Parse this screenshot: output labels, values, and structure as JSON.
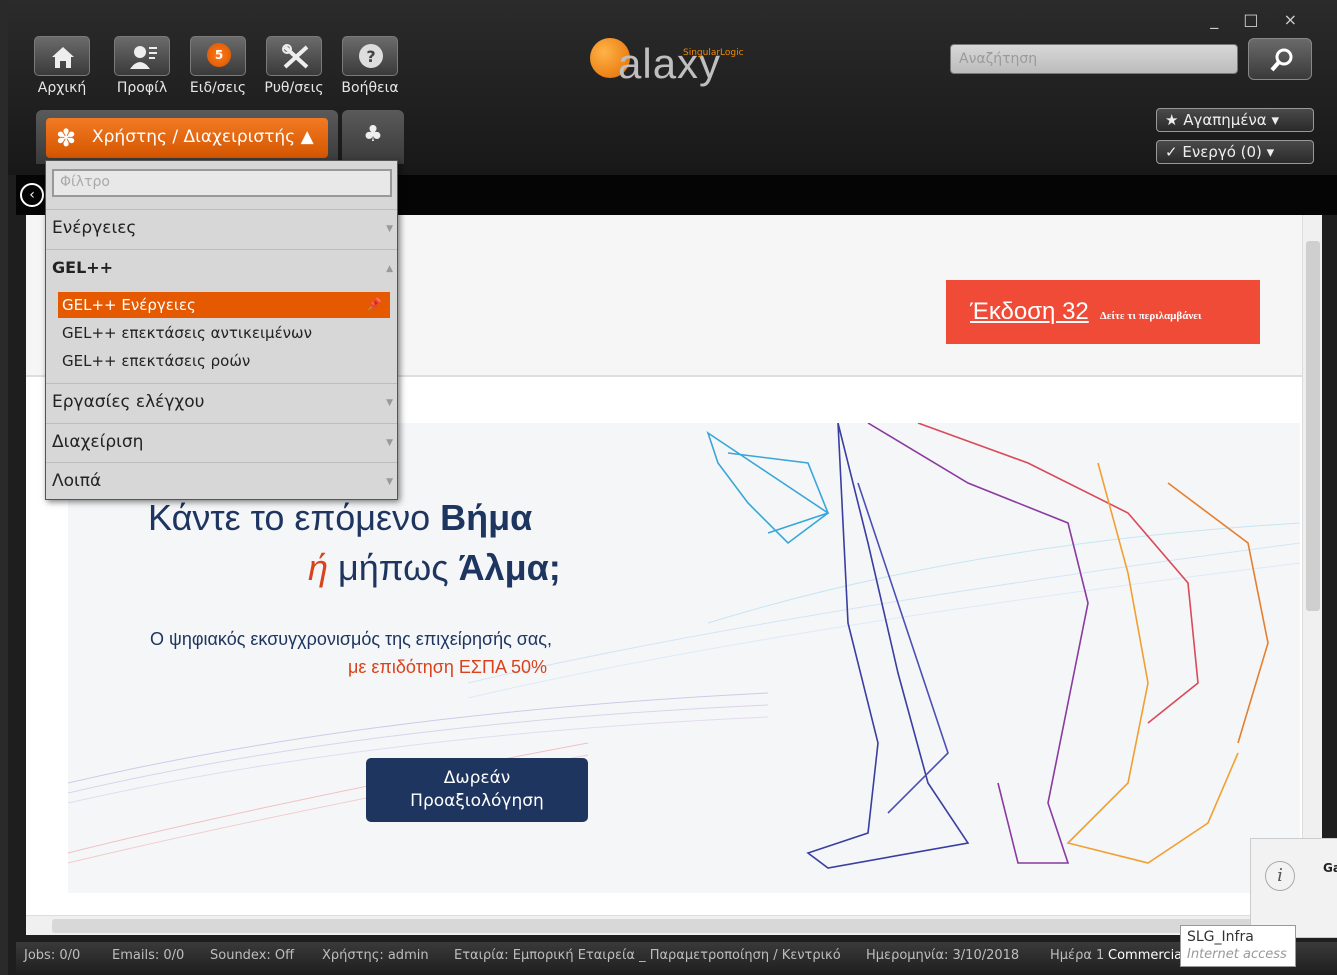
{
  "window": {
    "controls": "_ □ ×"
  },
  "nav": {
    "home": "Αρχική",
    "profile": "Προφίλ",
    "notifications": "Ειδ/σεις",
    "notifications_count": "5",
    "settings": "Ρυθ/σεις",
    "help": "Βοήθεια"
  },
  "logo": {
    "word": "alaxy",
    "brand": "SingularLogic"
  },
  "search": {
    "placeholder": "Αναζήτηση"
  },
  "favorites": "★ Αγαπημένα ▾",
  "active": "✓ Ενεργό (0) ▾",
  "role": {
    "label": "Χρήστης / Διαχειριστής ▲"
  },
  "menu": {
    "filter_placeholder": "Φίλτρο",
    "sections": [
      "Ενέργειες",
      "GEL++",
      "Εργασίες ελέγχου",
      "Διαχείριση",
      "Λοιπά"
    ],
    "gel_items": [
      "GEL++ Ενέργειες",
      "GEL++ επεκτάσεις αντικειμένων",
      "GEL++ επεκτάσεις ροών"
    ]
  },
  "version": {
    "label": "Έκδοση 32",
    "sub": "Δείτε τι περιλαμβάνει"
  },
  "banner": {
    "line1_a": "Κάντε το επόμενο ",
    "line1_b": "Βήμα",
    "line2_or": "ή",
    "line2_a": " μήπως ",
    "line2_b": "Άλμα;",
    "sub1": "Ο ψηφιακός εκσυγχρονισμός της επιχείρησής σας,",
    "sub2": "με επιδότηση ΕΣΠΑ 50%",
    "cta_line1": "Δωρεάν",
    "cta_line2": "Προαξιολόγηση"
  },
  "status": {
    "jobs": "Jobs: 0/0",
    "emails": "Emails: 0/0",
    "soundex": "Soundex: Off",
    "user": "Χρήστης: admin",
    "company": "Εταιρία: Εμπορική Εταιρεία _ Παραμετροποίηση / Κεντρικό",
    "date": "Ημερομηνία: 3/10/2018",
    "day": "Ημέρα 1",
    "commercial": "Commercia"
  },
  "tooltip": {
    "line1": "SLG_Infra",
    "line2": "Internet access"
  },
  "notify": {
    "title": "Ga"
  },
  "colors": {
    "accent": "#e55a00",
    "brand_navy": "#1e3560",
    "version_red": "#ef4b37"
  }
}
